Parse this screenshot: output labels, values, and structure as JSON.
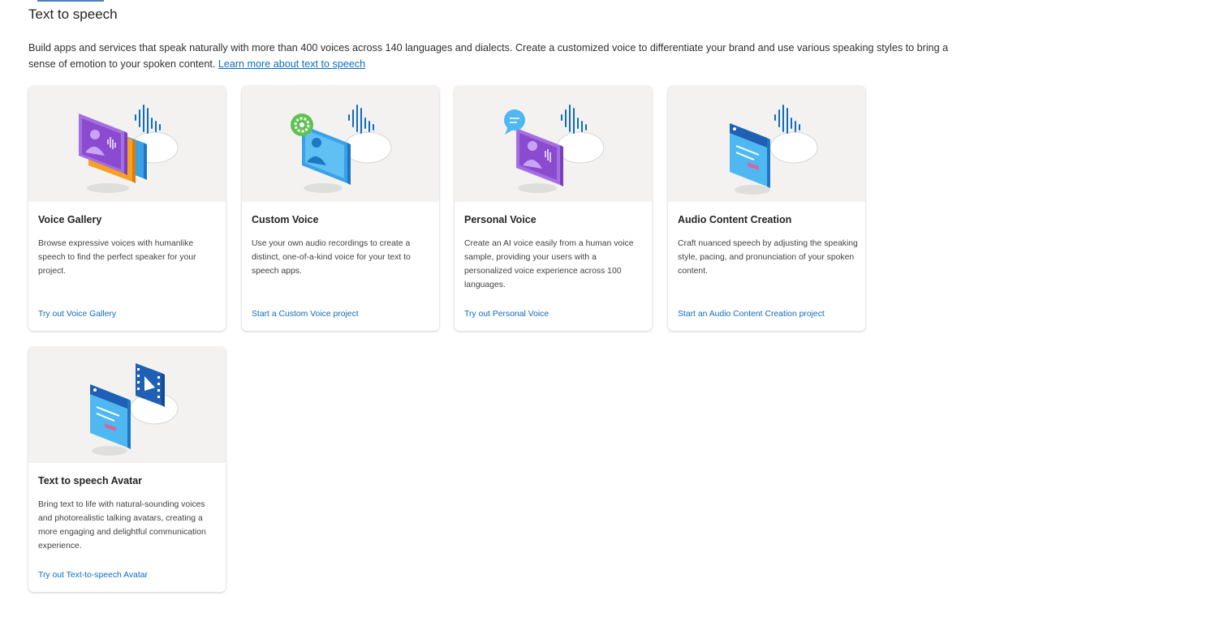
{
  "section": {
    "title": "Text to speech",
    "description": "Build apps and services that speak naturally with more than 400 voices across 140 languages and dialects. Create a customized voice to differentiate your brand and use various speaking styles to bring a sense of emotion to your spoken content. ",
    "learn_more_link": "Learn more about text to speech"
  },
  "cards": [
    {
      "title": "Voice Gallery",
      "description": "Browse expressive voices with humanlike speech to find the perfect speaker for your project.",
      "link": "Try out Voice Gallery",
      "illustration": "voice-gallery-illustration"
    },
    {
      "title": "Custom Voice",
      "description": "Use your own audio recordings to create a distinct, one-of-a-kind voice for your text to speech apps.",
      "link": "Start a Custom Voice project",
      "illustration": "custom-voice-illustration"
    },
    {
      "title": "Personal Voice",
      "description": "Create an AI voice easily from a human voice sample, providing your users with a personalized voice experience across 100 languages.",
      "link": "Try out Personal Voice",
      "illustration": "personal-voice-illustration"
    },
    {
      "title": "Audio Content Creation",
      "description": "Craft nuanced speech by adjusting the speaking style, pacing, and pronunciation of your spoken content.",
      "link": "Start an Audio Content Creation project",
      "illustration": "audio-content-creation-illustration"
    },
    {
      "title": "Text to speech Avatar",
      "description": "Bring text to life with natural-sounding voices and photorealistic talking avatars, creating a more engaging and delightful communication experience.",
      "link": "Try out Text-to-speech Avatar",
      "illustration": "avatar-illustration"
    }
  ],
  "colors": {
    "link": "#0f6cbd",
    "card_image_bg": "#f3f2f1",
    "purple": "#8a4bd0",
    "blue": "#2b88d8",
    "light_blue": "#50b8f0",
    "orange": "#f7a024",
    "green": "#5ec251",
    "wave": "#0f6cbd"
  }
}
